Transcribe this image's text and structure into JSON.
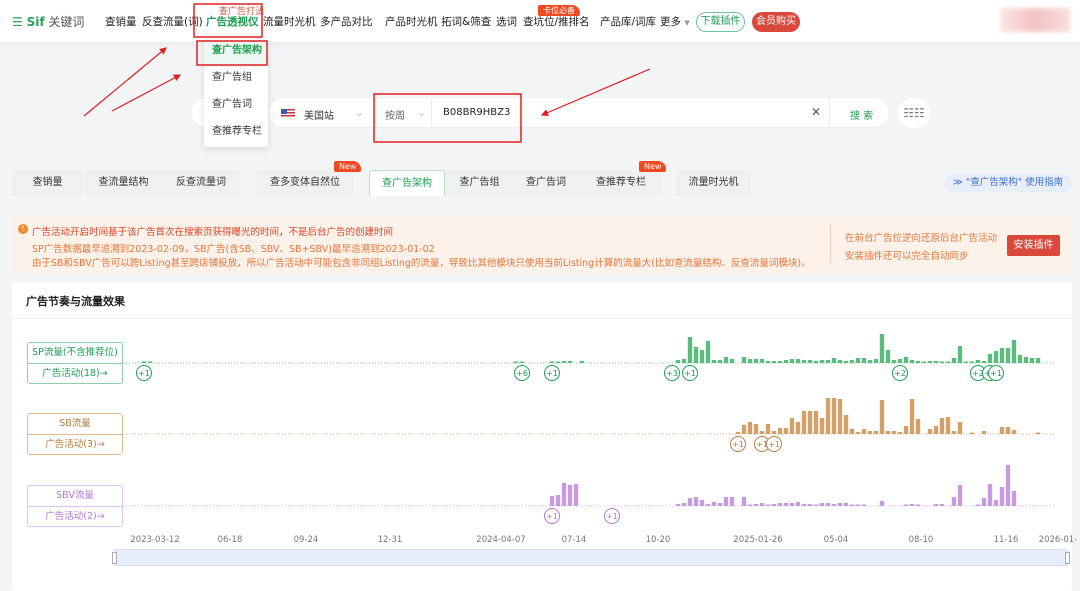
{
  "header": {
    "logo": "Sif",
    "logo_sub": "关键词",
    "nav": [
      "查销量",
      "反查流量(词)",
      "广告透视仪",
      "流量时光机",
      "多产品对比",
      "产品时光机",
      "拓词&筛查",
      "选词",
      "查坑位/推排名",
      "产品库/词库",
      "更多"
    ],
    "active_nav": "广告透视仪",
    "nav_sup": "查广告打法",
    "badge_hot": "卡位必备",
    "download_label": "下载插件",
    "vip_label": "会员购买"
  },
  "dropdown": {
    "items": [
      "查广告架构",
      "查广告组",
      "查广告词",
      "查推荐专栏"
    ],
    "selected": "查广告架构"
  },
  "search": {
    "marketplace": "美国站",
    "period": "按周",
    "asin": "B08BR9HBZ3",
    "button": "搜 索"
  },
  "tabs": {
    "items": [
      "查销量",
      "查流量结构",
      "反查流量词",
      "查多变体自然位",
      "查广告架构",
      "查广告组",
      "查广告词",
      "查推荐专栏",
      "流量时光机"
    ],
    "active": "查广告架构",
    "new_badge": "New",
    "guide": "≫ \"查广告架构\" 使用指南"
  },
  "notice": {
    "title": "广告活动开启时间基于该广告首次在搜索页获得曝光的时间，不是后台广告的创建时间",
    "line1": "SP广告数据最早追溯到2023-02-09，SB广告(含SB、SBV、SB+SBV)最早追溯到2023-01-02",
    "line2": "由于SB和SBV广告可以跨Listing甚至跨店铺投放，所以广告活动中可能包含非同组Listing的流量，导致比其他模块只使用当前Listing计算的流量大(比如查流量结构、反查流量词模块)。",
    "right1": "在前台广告位逆向还原后台广告活动",
    "right2": "安装插件还可以完全自动同步",
    "install": "安装插件"
  },
  "chart_card": {
    "title": "广告节奏与流量效果"
  },
  "chart_data": {
    "type": "bar",
    "x_start": "2023-02-26",
    "interval": "week",
    "xticks": [
      "2023-03-12",
      "06-18",
      "09-24",
      "12-31",
      "2024-04-07",
      "07-14",
      "10-20",
      "2025-01-26",
      "05-04",
      "08-10",
      "11-16",
      "2026-01-"
    ],
    "series": [
      {
        "name": "SP流量(不含推荐位)",
        "activity_label": "广告活动(18)→",
        "color": "#5dbb7e",
        "segments": [
          {
            "from": "2023-03-05",
            "values": [
              1,
              1
            ]
          },
          {
            "from": "2024-05-12",
            "values": [
              1,
              1,
              0,
              0,
              0,
              0,
              1,
              1,
              2,
              2,
              0,
              2
            ]
          },
          {
            "from": "2024-11-17",
            "values": [
              3,
              4,
              26,
              16,
              13,
              22,
              3,
              3,
              6,
              4,
              0,
              6,
              4,
              4,
              4,
              2,
              2,
              2,
              3,
              4,
              4,
              3,
              3,
              2,
              3,
              3,
              5,
              3,
              2,
              3,
              5,
              5,
              3,
              4,
              29,
              13,
              3,
              4,
              6,
              3,
              2,
              1,
              2,
              2,
              1,
              1,
              5,
              17,
              1,
              1,
              3,
              2,
              9,
              12,
              15,
              15,
              23,
              8,
              6,
              5,
              5
            ]
          }
        ],
        "markers": [
          [
            "2023-03-05",
            "+1"
          ],
          [
            "2024-05-19",
            "+6"
          ],
          [
            "2024-06-23",
            "+1"
          ],
          [
            "2024-11-10",
            "+3"
          ],
          [
            "2024-12-01",
            "+1"
          ],
          [
            "2025-08-03",
            "+2"
          ],
          [
            "2025-11-02",
            "+2"
          ],
          [
            "2025-11-16",
            "+1"
          ],
          [
            "2025-11-23",
            "+1"
          ]
        ]
      },
      {
        "name": "SB流量",
        "activity_label": "广告活动(3)→",
        "color": "#d4a06a",
        "segments": [
          {
            "from": "2025-01-26",
            "values": [
              2,
              9,
              12,
              10,
              3,
              10,
              3,
              6,
              6,
              16,
              12,
              23,
              23,
              23,
              16,
              36,
              36,
              35,
              19,
              5,
              2,
              5,
              3,
              3,
              34,
              3,
              3,
              2,
              8,
              35,
              15,
              0,
              5,
              8,
              16,
              17,
              3,
              12,
              0,
              0.5,
              0,
              3,
              0,
              0,
              7,
              7,
              4,
              0,
              0,
              0,
              1
            ]
          }
        ],
        "markers": [
          [
            "2025-01-26",
            "+1"
          ],
          [
            "2025-02-23",
            "+1"
          ],
          [
            "2025-03-09",
            "+1"
          ]
        ]
      },
      {
        "name": "SBV流量",
        "activity_label": "广告活动(2)→",
        "color": "#c79be0",
        "segments": [
          {
            "from": "2024-06-23",
            "values": [
              10,
              11,
              23,
              21,
              22
            ]
          },
          {
            "from": "2024-11-17",
            "values": [
              2,
              3,
              8,
              9,
              6,
              2,
              4,
              3,
              9,
              9,
              0,
              9,
              1,
              2,
              3,
              1,
              2,
              3,
              3,
              3,
              4,
              2,
              2,
              1,
              3,
              3,
              2,
              3,
              3,
              1,
              1,
              1,
              0,
              0,
              5,
              0,
              0,
              0,
              1,
              2,
              1,
              0,
              0,
              2,
              2,
              0,
              9,
              21,
              0,
              0,
              1,
              8,
              22,
              6,
              19,
              41,
              15
            ]
          }
        ],
        "markers": [
          [
            "2024-06-23",
            "+1"
          ],
          [
            "2024-09-01",
            "+1"
          ]
        ]
      }
    ]
  },
  "colors": {
    "brand": "#1f9d55",
    "danger": "#d9483b",
    "sp": "#1f9d55",
    "sb": "#b87a3a",
    "sbv": "#b07ad6"
  }
}
